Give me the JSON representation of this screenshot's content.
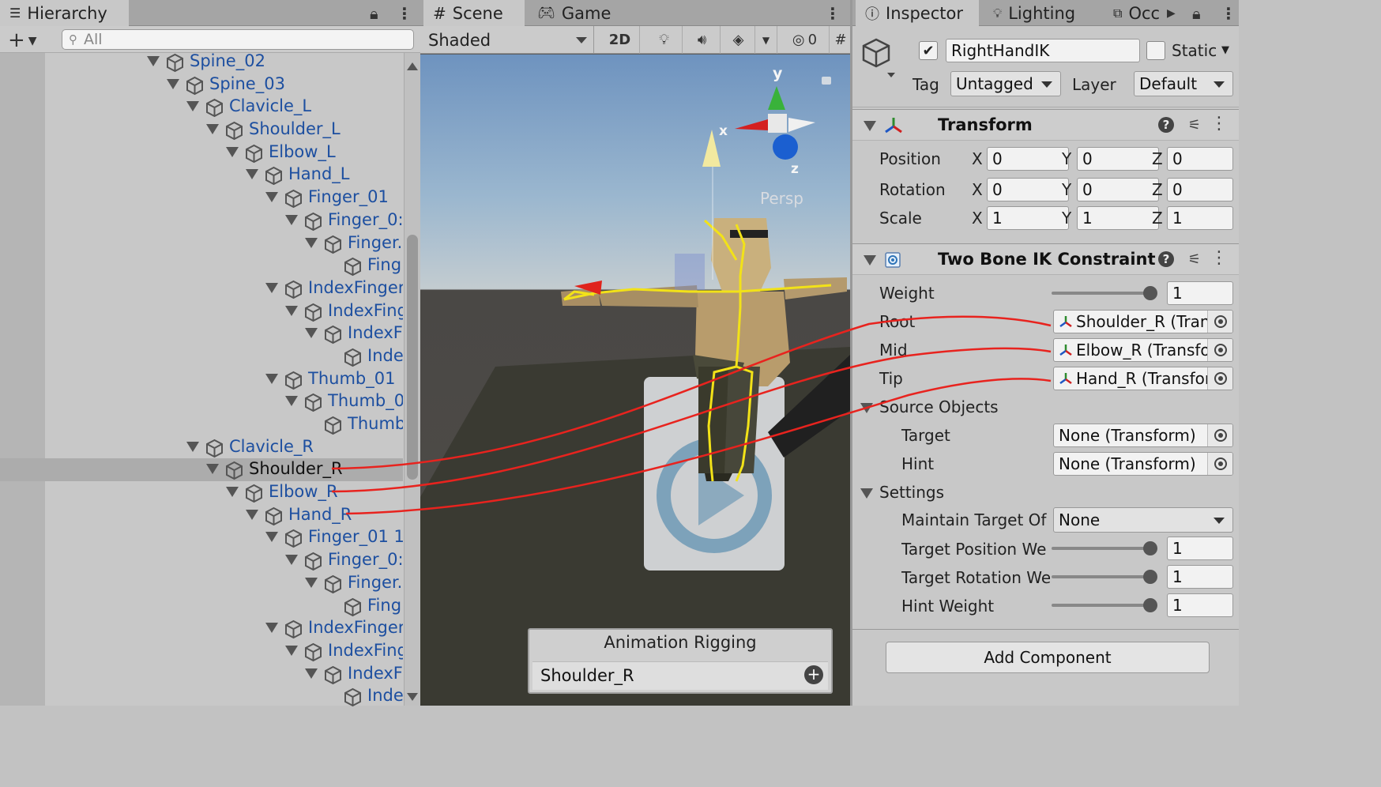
{
  "hierarchy": {
    "tab_label": "Hierarchy",
    "search_placeholder": "All",
    "rows": [
      {
        "label": "Spine_02"
      },
      {
        "label": "Spine_03"
      },
      {
        "label": "Clavicle_L"
      },
      {
        "label": "Shoulder_L"
      },
      {
        "label": "Elbow_L"
      },
      {
        "label": "Hand_L"
      },
      {
        "label": "Finger_01"
      },
      {
        "label": "Finger_0:"
      },
      {
        "label": "Finger."
      },
      {
        "label": "Fing"
      },
      {
        "label": "IndexFinger"
      },
      {
        "label": "IndexFing"
      },
      {
        "label": "IndexF"
      },
      {
        "label": "Inde"
      },
      {
        "label": "Thumb_01"
      },
      {
        "label": "Thumb_0"
      },
      {
        "label": "Thumb"
      },
      {
        "label": "Clavicle_R"
      },
      {
        "label": "Shoulder_R"
      },
      {
        "label": "Elbow_R"
      },
      {
        "label": "Hand_R"
      },
      {
        "label": "Finger_01 1"
      },
      {
        "label": "Finger_0:"
      },
      {
        "label": "Finger."
      },
      {
        "label": "Fing"
      },
      {
        "label": "IndexFinger"
      },
      {
        "label": "IndexFing"
      },
      {
        "label": "IndexF"
      },
      {
        "label": "Inde"
      }
    ]
  },
  "scene": {
    "tab_scene": "Scene",
    "tab_game": "Game",
    "shading_mode": "Shaded",
    "btn_2d": "2D",
    "hidden_count": "0",
    "persp_label": "Persp",
    "gizmo_x": "x",
    "gizmo_y": "y",
    "gizmo_z": "z",
    "overlay": {
      "title": "Animation Rigging",
      "field_value": "Shoulder_R"
    }
  },
  "inspector": {
    "tab_inspector": "Inspector",
    "tab_lighting": "Lighting",
    "tab_occlusion": "Occ",
    "object_name": "RightHandIK",
    "static_label": "Static",
    "tag_label": "Tag",
    "tag_value": "Untagged",
    "layer_label": "Layer",
    "layer_value": "Default",
    "transform": {
      "title": "Transform",
      "position_label": "Position",
      "rotation_label": "Rotation",
      "scale_label": "Scale",
      "axis_x": "X",
      "axis_y": "Y",
      "axis_z": "Z",
      "position": [
        "0",
        "0",
        "0"
      ],
      "rotation": [
        "0",
        "0",
        "0"
      ],
      "scale": [
        "1",
        "1",
        "1"
      ]
    },
    "ik": {
      "title": "Two Bone IK Constraint",
      "weight_label": "Weight",
      "weight_value": "1",
      "root_label": "Root",
      "root_value": "Shoulder_R (Tran",
      "mid_label": "Mid",
      "mid_value": "Elbow_R (Transfo",
      "tip_label": "Tip",
      "tip_value": "Hand_R (Transfor",
      "source_objects_label": "Source Objects",
      "target_label": "Target",
      "target_value": "None (Transform)",
      "hint_label": "Hint",
      "hint_value": "None (Transform)",
      "settings_label": "Settings",
      "maintain_label": "Maintain Target Of",
      "maintain_value": "None",
      "target_pos_label": "Target Position We",
      "target_pos_value": "1",
      "target_rot_label": "Target Rotation We",
      "target_rot_value": "1",
      "hint_weight_label": "Hint Weight",
      "hint_weight_value": "1"
    },
    "add_component_label": "Add Component"
  },
  "colors": {
    "link_text": "#1d4fa0",
    "connection_wire": "#e8231e",
    "bone_yellow": "#f2e218"
  }
}
